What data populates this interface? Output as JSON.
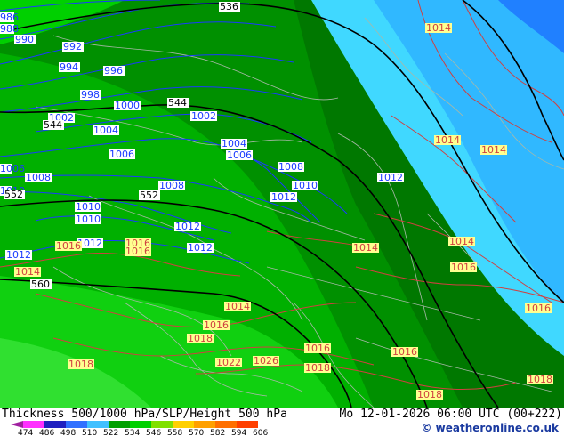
{
  "title": "Thickness 500/1000 hPa/SLP/Height 500 hPa",
  "datetime": "Mo 12-01-2026 06:00 UTC (00+222)",
  "credit": "© weatheronline.co.uk",
  "legend": {
    "ticks": [
      "474",
      "486",
      "498",
      "510",
      "522",
      "534",
      "546",
      "558",
      "570",
      "582",
      "594",
      "606"
    ],
    "colors": [
      "#a020a0",
      "#ff30ff",
      "#2020c0",
      "#3070ff",
      "#40c0ff",
      "#00a000",
      "#00d000",
      "#80e000",
      "#ffd000",
      "#ffa000",
      "#ff7000",
      "#ff4000"
    ]
  },
  "isobar_labels": {
    "blue": [
      "986",
      "988",
      "990",
      "992",
      "994",
      "996",
      "998",
      "1000",
      "1002",
      "1002",
      "1004",
      "1004",
      "1006",
      "1006",
      "1006",
      "1008",
      "1008",
      "1008",
      "1010",
      "1010",
      "1010",
      "1010",
      "1012",
      "1012",
      "1012",
      "1012",
      "1012",
      "1012"
    ],
    "red": [
      "1014",
      "1014",
      "1014",
      "1014",
      "1014",
      "1014",
      "1014",
      "1016",
      "1016",
      "1016",
      "1016",
      "1016",
      "1016",
      "1016",
      "1016",
      "1018",
      "1018",
      "1018",
      "1018",
      "1018",
      "1022",
      "1026"
    ]
  },
  "height_labels": [
    "536",
    "544",
    "544",
    "552",
    "552",
    "560"
  ],
  "colors": {
    "dark_green": "#007800",
    "mid_green": "#00a000",
    "bright_green": "#00c800",
    "cyan": "#40d8ff",
    "light_cyan": "#60f0ff",
    "blue": "#2080ff",
    "isobar_blue": "#1a3aff",
    "isobar_red": "#d04040",
    "label_bg_red": "#ffff90"
  }
}
